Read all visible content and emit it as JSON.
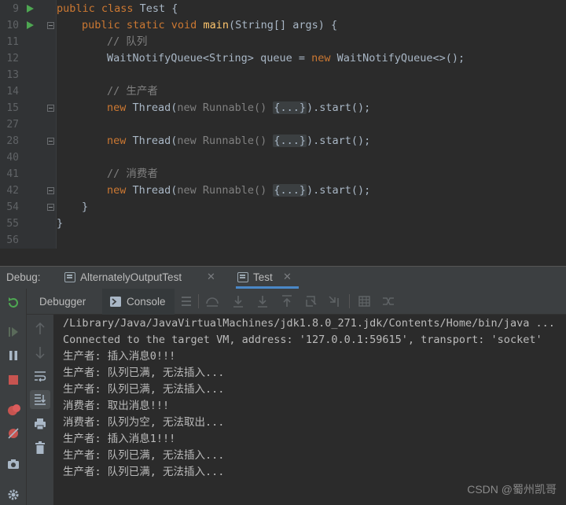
{
  "editor": {
    "lines": [
      {
        "num": "9",
        "run": true
      },
      {
        "num": "10",
        "run": true
      },
      {
        "num": "11"
      },
      {
        "num": "12"
      },
      {
        "num": "13"
      },
      {
        "num": "14"
      },
      {
        "num": "15"
      },
      {
        "num": "27"
      },
      {
        "num": "28"
      },
      {
        "num": "40"
      },
      {
        "num": "41"
      },
      {
        "num": "42"
      },
      {
        "num": "54"
      },
      {
        "num": "55"
      },
      {
        "num": "56"
      }
    ],
    "code": {
      "l9_kw": "public class ",
      "l9_rest": "Test {",
      "l10_kw": "public static void ",
      "l10_fn": "main",
      "l10_rest": "(String[] args) {",
      "l11": "// 队列",
      "l12_a": "WaitNotifyQueue<String> queue = ",
      "l12_kw": "new ",
      "l12_b": "WaitNotifyQueue<>();",
      "l14": "// 生产者",
      "new_kw": "new ",
      "thread": "Thread(",
      "runnable": "new Runnable() ",
      "folded": "{...}",
      "start": ").start();",
      "l41": "// 消费者",
      "l54": "}",
      "l55": "}"
    }
  },
  "debug": {
    "label": "Debug:",
    "tabs": [
      {
        "label": "AlternatelyOutputTest",
        "close": "✕"
      },
      {
        "label": "Test",
        "close": "✕"
      }
    ]
  },
  "subbar": {
    "debugger": "Debugger",
    "console": "Console"
  },
  "console": {
    "lines": [
      "/Library/Java/JavaVirtualMachines/jdk1.8.0_271.jdk/Contents/Home/bin/java ...",
      "Connected to the target VM, address: '127.0.0.1:59615', transport: 'socket'",
      "生产者: 插入消息0!!!",
      "生产者: 队列已满, 无法插入...",
      "生产者: 队列已满, 无法插入...",
      "消费者: 取出消息!!!",
      "消费者: 队列为空, 无法取出...",
      "生产者: 插入消息1!!!",
      "生产者: 队列已满, 无法插入...",
      "生产者: 队列已满, 无法插入..."
    ]
  },
  "watermark": "CSDN @蜀州凯哥",
  "colors": {
    "run_green": "#4ea752",
    "stop_red": "#c75450",
    "accent_blue": "#4a88c7"
  }
}
